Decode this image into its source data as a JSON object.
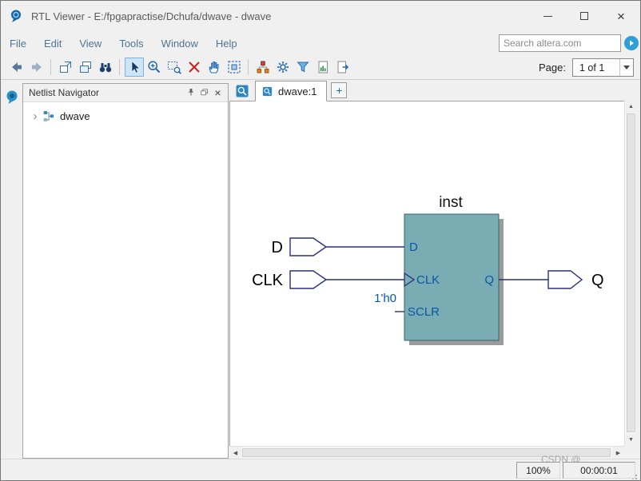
{
  "window": {
    "title": "RTL Viewer - E:/fpgapractise/Dchufa/dwave - dwave"
  },
  "menu": {
    "items": [
      "File",
      "Edit",
      "View",
      "Tools",
      "Window",
      "Help"
    ]
  },
  "search": {
    "placeholder": "Search altera.com"
  },
  "toolbar": {
    "page_label": "Page:",
    "page_value": "1 of 1",
    "icons": [
      "back",
      "forward",
      "detach-page",
      "cascade-windows",
      "find-binoculars",
      "select-pointer",
      "zoom-in",
      "zoom-area",
      "zoom-selection",
      "pan-hand",
      "fit-view",
      "hierarchy-up",
      "settings-gear",
      "filter",
      "report",
      "export"
    ]
  },
  "navigator": {
    "title": "Netlist Navigator",
    "items": [
      {
        "label": "dwave"
      }
    ]
  },
  "tabbar": {
    "active_tab": "dwave:1",
    "add_label": "+"
  },
  "schematic": {
    "instance_label": "inst",
    "input_pins": [
      {
        "label": "D"
      },
      {
        "label": "CLK"
      }
    ],
    "constant_label": "1'h0",
    "port_labels": {
      "d": "D",
      "clk": "CLK",
      "sclr": "SCLR",
      "q": "Q"
    },
    "output_pins": [
      {
        "label": "Q"
      }
    ]
  },
  "statusbar": {
    "zoom": "100%",
    "elapsed": "00:00:01",
    "watermark": "CSDN @..."
  },
  "glyphs": {
    "close": "×",
    "expander": "›",
    "up": "▲",
    "down": "▼",
    "left": "◀",
    "right": "▶"
  },
  "colors": {
    "node_fill": "#7aacb4",
    "wire": "#28327f",
    "port_text": "#0a57a4",
    "selection": "#cde6f7"
  }
}
